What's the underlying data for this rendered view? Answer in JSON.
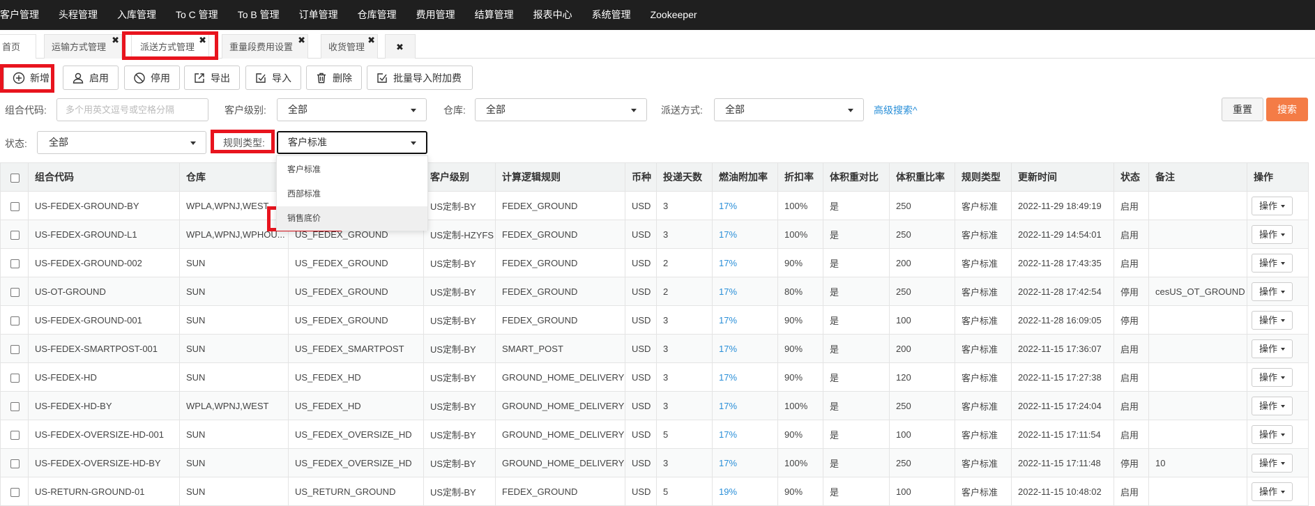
{
  "topnav": [
    "客户管理",
    "头程管理",
    "入库管理",
    "To C 管理",
    "To B 管理",
    "订单管理",
    "仓库管理",
    "费用管理",
    "结算管理",
    "报表中心",
    "系统管理",
    "Zookeeper"
  ],
  "tabs": {
    "home": "首页",
    "items": [
      "运输方式管理",
      "派送方式管理",
      "重量段费用设置",
      "收货管理"
    ],
    "close_symbol": "✖"
  },
  "toolbar": {
    "add": "新增",
    "enable": "启用",
    "disable": "停用",
    "export": "导出",
    "import": "导入",
    "delete": "删除",
    "batch_import": "批量导入附加费"
  },
  "filters": {
    "group_code_label": "组合代码:",
    "group_code_placeholder": "多个用英文逗号或空格分隔",
    "customer_level_label": "客户级别:",
    "customer_level_value": "全部",
    "warehouse_label": "仓库:",
    "warehouse_value": "全部",
    "delivery_label": "派送方式:",
    "delivery_value": "全部",
    "advanced_search": "高级搜索^",
    "reset": "重置",
    "search": "搜索",
    "status_label": "状态:",
    "status_value": "全部",
    "rule_type_label": "规则类型:",
    "rule_type_value": "客户标准"
  },
  "dropdown": [
    "客户标准",
    "西部标准",
    "销售底价"
  ],
  "table": {
    "headers": [
      "组合代码",
      "仓库",
      "",
      "客户级别",
      "计算逻辑规则",
      "币种",
      "投递天数",
      "燃油附加率",
      "折扣率",
      "体积重对比",
      "体积重比率",
      "规则类型",
      "更新时间",
      "状态",
      "备注",
      "操作"
    ],
    "op_label": "操作",
    "rows": [
      [
        "US-FEDEX-GROUND-BY",
        "WPLA,WPNJ,WEST",
        "",
        "US定制-BY",
        "FEDEX_GROUND",
        "USD",
        "3",
        "17%",
        "100%",
        "是",
        "250",
        "客户标准",
        "2022-11-29 18:49:19",
        "启用",
        ""
      ],
      [
        "US-FEDEX-GROUND-L1",
        "WPLA,WPNJ,WPHOU...",
        "US_FEDEX_GROUND",
        "US定制-HZYFS",
        "FEDEX_GROUND",
        "USD",
        "3",
        "17%",
        "100%",
        "是",
        "250",
        "客户标准",
        "2022-11-29 14:54:01",
        "启用",
        ""
      ],
      [
        "US-FEDEX-GROUND-002",
        "SUN",
        "US_FEDEX_GROUND",
        "US定制-BY",
        "FEDEX_GROUND",
        "USD",
        "2",
        "17%",
        "90%",
        "是",
        "200",
        "客户标准",
        "2022-11-28 17:43:35",
        "启用",
        ""
      ],
      [
        "US-OT-GROUND",
        "SUN",
        "US_FEDEX_GROUND",
        "US定制-BY",
        "FEDEX_GROUND",
        "USD",
        "2",
        "17%",
        "80%",
        "是",
        "250",
        "客户标准",
        "2022-11-28 17:42:54",
        "停用",
        "cesUS_OT_GROUND"
      ],
      [
        "US-FEDEX-GROUND-001",
        "SUN",
        "US_FEDEX_GROUND",
        "US定制-BY",
        "FEDEX_GROUND",
        "USD",
        "3",
        "17%",
        "90%",
        "是",
        "100",
        "客户标准",
        "2022-11-28 16:09:05",
        "停用",
        ""
      ],
      [
        "US-FEDEX-SMARTPOST-001",
        "SUN",
        "US_FEDEX_SMARTPOST",
        "US定制-BY",
        "SMART_POST",
        "USD",
        "3",
        "17%",
        "90%",
        "是",
        "200",
        "客户标准",
        "2022-11-15 17:36:07",
        "启用",
        ""
      ],
      [
        "US-FEDEX-HD",
        "SUN",
        "US_FEDEX_HD",
        "US定制-BY",
        "GROUND_HOME_DELIVERY",
        "USD",
        "3",
        "17%",
        "90%",
        "是",
        "120",
        "客户标准",
        "2022-11-15 17:27:38",
        "启用",
        ""
      ],
      [
        "US-FEDEX-HD-BY",
        "WPLA,WPNJ,WEST",
        "US_FEDEX_HD",
        "US定制-BY",
        "GROUND_HOME_DELIVERY",
        "USD",
        "3",
        "17%",
        "100%",
        "是",
        "250",
        "客户标准",
        "2022-11-15 17:24:04",
        "启用",
        ""
      ],
      [
        "US-FEDEX-OVERSIZE-HD-001",
        "SUN",
        "US_FEDEX_OVERSIZE_HD",
        "US定制-BY",
        "GROUND_HOME_DELIVERY",
        "USD",
        "5",
        "17%",
        "90%",
        "是",
        "100",
        "客户标准",
        "2022-11-15 17:11:54",
        "启用",
        ""
      ],
      [
        "US-FEDEX-OVERSIZE-HD-BY",
        "SUN",
        "US_FEDEX_OVERSIZE_HD",
        "US定制-BY",
        "GROUND_HOME_DELIVERY",
        "USD",
        "3",
        "17%",
        "100%",
        "是",
        "250",
        "客户标准",
        "2022-11-15 17:11:48",
        "停用",
        "10"
      ],
      [
        "US-RETURN-GROUND-01",
        "SUN",
        "US_RETURN_GROUND",
        "US定制-BY",
        "FEDEX_GROUND",
        "USD",
        "5",
        "19%",
        "90%",
        "是",
        "100",
        "客户标准",
        "2022-11-15 10:48:02",
        "启用",
        ""
      ]
    ]
  },
  "colors": {
    "nav_bg": "#1f1f1f",
    "highlight": "#e8141e",
    "link": "#2a8fd8",
    "search_btn": "#f47c46"
  }
}
